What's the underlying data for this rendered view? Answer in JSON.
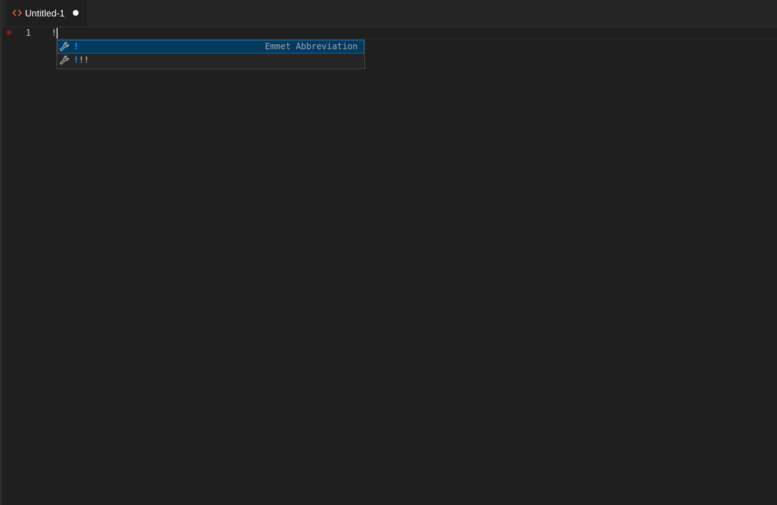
{
  "tabs": [
    {
      "label": "Untitled-1",
      "icon": "html-brackets-icon",
      "dirty": true,
      "active": true
    }
  ],
  "editor": {
    "line_numbers": [
      "1"
    ],
    "lines": [
      "!"
    ]
  },
  "suggest": {
    "items": [
      {
        "match": "!",
        "rest": "",
        "detail": "Emmet Abbreviation",
        "icon": "wrench-icon",
        "selected": true
      },
      {
        "match": "!",
        "rest": "!!",
        "detail": "",
        "icon": "wrench-icon",
        "selected": false
      }
    ]
  },
  "colors": {
    "accent_tab_icon": "#e8623a",
    "highlight": "#18a3ff",
    "selected_bg": "#04395e",
    "breakpoint": "#7a1d1d"
  }
}
